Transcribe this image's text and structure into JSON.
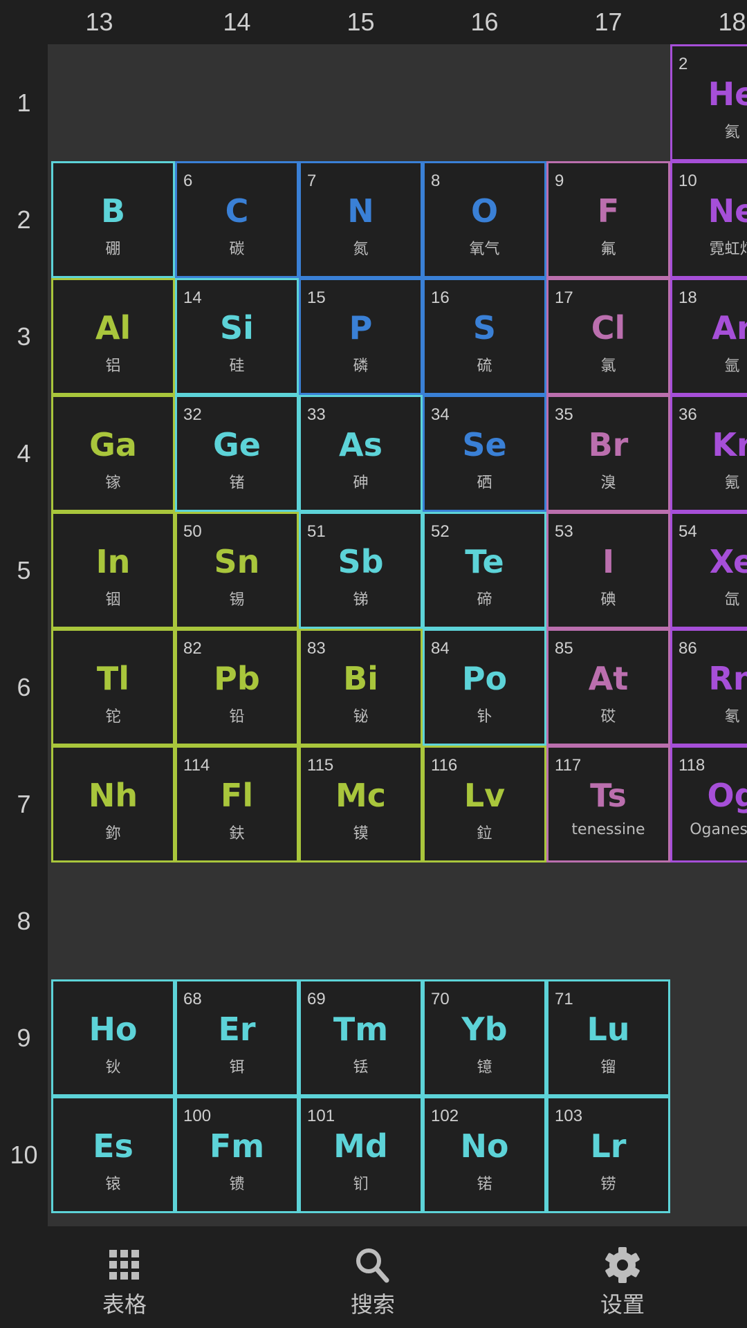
{
  "colors": {
    "metalloid": "#5dd3d8",
    "nonmetal": "#3a80d6",
    "halogen": "#bb6fae",
    "noble": "#a64fd8",
    "post_transition": "#a9c63c",
    "lanthanide": "#5dd3d8",
    "actinide": "#5dd3d8"
  },
  "group_headers": [
    "13",
    "14",
    "15",
    "16",
    "17",
    "18"
  ],
  "period_headers": [
    "1",
    "2",
    "3",
    "4",
    "5",
    "6",
    "7",
    "8",
    "9",
    "10"
  ],
  "elements": [
    {
      "row": 1,
      "col": 18,
      "number": "2",
      "symbol": "He",
      "name": "氦",
      "category": "noble"
    },
    {
      "row": 2,
      "col": 13,
      "symbol": "B",
      "name": "硼",
      "category": "metalloid"
    },
    {
      "row": 2,
      "col": 14,
      "number": "6",
      "symbol": "C",
      "name": "碳",
      "category": "nonmetal"
    },
    {
      "row": 2,
      "col": 15,
      "number": "7",
      "symbol": "N",
      "name": "氮",
      "category": "nonmetal"
    },
    {
      "row": 2,
      "col": 16,
      "number": "8",
      "symbol": "O",
      "name": "氧气",
      "category": "nonmetal"
    },
    {
      "row": 2,
      "col": 17,
      "number": "9",
      "symbol": "F",
      "name": "氟",
      "category": "halogen"
    },
    {
      "row": 2,
      "col": 18,
      "number": "10",
      "symbol": "Ne",
      "name": "霓虹灯",
      "category": "noble"
    },
    {
      "row": 3,
      "col": 13,
      "symbol": "Al",
      "name": "铝",
      "category": "post_transition"
    },
    {
      "row": 3,
      "col": 14,
      "number": "14",
      "symbol": "Si",
      "name": "硅",
      "category": "metalloid"
    },
    {
      "row": 3,
      "col": 15,
      "number": "15",
      "symbol": "P",
      "name": "磷",
      "category": "nonmetal"
    },
    {
      "row": 3,
      "col": 16,
      "number": "16",
      "symbol": "S",
      "name": "硫",
      "category": "nonmetal"
    },
    {
      "row": 3,
      "col": 17,
      "number": "17",
      "symbol": "Cl",
      "name": "氯",
      "category": "halogen"
    },
    {
      "row": 3,
      "col": 18,
      "number": "18",
      "symbol": "Ar",
      "name": "氩",
      "category": "noble"
    },
    {
      "row": 4,
      "col": 13,
      "symbol": "Ga",
      "name": "镓",
      "category": "post_transition"
    },
    {
      "row": 4,
      "col": 14,
      "number": "32",
      "symbol": "Ge",
      "name": "锗",
      "category": "metalloid"
    },
    {
      "row": 4,
      "col": 15,
      "number": "33",
      "symbol": "As",
      "name": "砷",
      "category": "metalloid"
    },
    {
      "row": 4,
      "col": 16,
      "number": "34",
      "symbol": "Se",
      "name": "硒",
      "category": "nonmetal"
    },
    {
      "row": 4,
      "col": 17,
      "number": "35",
      "symbol": "Br",
      "name": "溴",
      "category": "halogen"
    },
    {
      "row": 4,
      "col": 18,
      "number": "36",
      "symbol": "Kr",
      "name": "氪",
      "category": "noble"
    },
    {
      "row": 5,
      "col": 13,
      "symbol": "In",
      "name": "铟",
      "category": "post_transition"
    },
    {
      "row": 5,
      "col": 14,
      "number": "50",
      "symbol": "Sn",
      "name": "锡",
      "category": "post_transition"
    },
    {
      "row": 5,
      "col": 15,
      "number": "51",
      "symbol": "Sb",
      "name": "锑",
      "category": "metalloid"
    },
    {
      "row": 5,
      "col": 16,
      "number": "52",
      "symbol": "Te",
      "name": "碲",
      "category": "metalloid"
    },
    {
      "row": 5,
      "col": 17,
      "number": "53",
      "symbol": "I",
      "name": "碘",
      "category": "halogen"
    },
    {
      "row": 5,
      "col": 18,
      "number": "54",
      "symbol": "Xe",
      "name": "氙",
      "category": "noble"
    },
    {
      "row": 6,
      "col": 13,
      "symbol": "Tl",
      "name": "铊",
      "category": "post_transition"
    },
    {
      "row": 6,
      "col": 14,
      "number": "82",
      "symbol": "Pb",
      "name": "铅",
      "category": "post_transition"
    },
    {
      "row": 6,
      "col": 15,
      "number": "83",
      "symbol": "Bi",
      "name": "铋",
      "category": "post_transition"
    },
    {
      "row": 6,
      "col": 16,
      "number": "84",
      "symbol": "Po",
      "name": "钋",
      "category": "metalloid"
    },
    {
      "row": 6,
      "col": 17,
      "number": "85",
      "symbol": "At",
      "name": "砹",
      "category": "halogen"
    },
    {
      "row": 6,
      "col": 18,
      "number": "86",
      "symbol": "Rn",
      "name": "氡",
      "category": "noble"
    },
    {
      "row": 7,
      "col": 13,
      "symbol": "Nh",
      "name": "鉨",
      "category": "post_transition"
    },
    {
      "row": 7,
      "col": 14,
      "number": "114",
      "symbol": "Fl",
      "name": "鈇",
      "category": "post_transition"
    },
    {
      "row": 7,
      "col": 15,
      "number": "115",
      "symbol": "Mc",
      "name": "镆",
      "category": "post_transition"
    },
    {
      "row": 7,
      "col": 16,
      "number": "116",
      "symbol": "Lv",
      "name": "鉝",
      "category": "post_transition"
    },
    {
      "row": 7,
      "col": 17,
      "number": "117",
      "symbol": "Ts",
      "name": "tenessine",
      "category": "halogen"
    },
    {
      "row": 7,
      "col": 18,
      "number": "118",
      "symbol": "Og",
      "name": "Oganesson",
      "category": "noble"
    },
    {
      "row": 9,
      "col": 13,
      "symbol": "Ho",
      "name": "钬",
      "category": "lanthanide"
    },
    {
      "row": 9,
      "col": 14,
      "number": "68",
      "symbol": "Er",
      "name": "铒",
      "category": "lanthanide"
    },
    {
      "row": 9,
      "col": 15,
      "number": "69",
      "symbol": "Tm",
      "name": "铥",
      "category": "lanthanide"
    },
    {
      "row": 9,
      "col": 16,
      "number": "70",
      "symbol": "Yb",
      "name": "镱",
      "category": "lanthanide"
    },
    {
      "row": 9,
      "col": 17,
      "number": "71",
      "symbol": "Lu",
      "name": "镏",
      "category": "lanthanide"
    },
    {
      "row": 10,
      "col": 13,
      "symbol": "Es",
      "name": "锿",
      "category": "actinide"
    },
    {
      "row": 10,
      "col": 14,
      "number": "100",
      "symbol": "Fm",
      "name": "镄",
      "category": "actinide"
    },
    {
      "row": 10,
      "col": 15,
      "number": "101",
      "symbol": "Md",
      "name": "钔",
      "category": "actinide"
    },
    {
      "row": 10,
      "col": 16,
      "number": "102",
      "symbol": "No",
      "name": "锘",
      "category": "actinide"
    },
    {
      "row": 10,
      "col": 17,
      "number": "103",
      "symbol": "Lr",
      "name": "铹",
      "category": "actinide"
    }
  ],
  "nav": [
    {
      "label": "表格",
      "icon": "grid-icon"
    },
    {
      "label": "搜索",
      "icon": "search-icon"
    },
    {
      "label": "设置",
      "icon": "gear-icon"
    }
  ]
}
